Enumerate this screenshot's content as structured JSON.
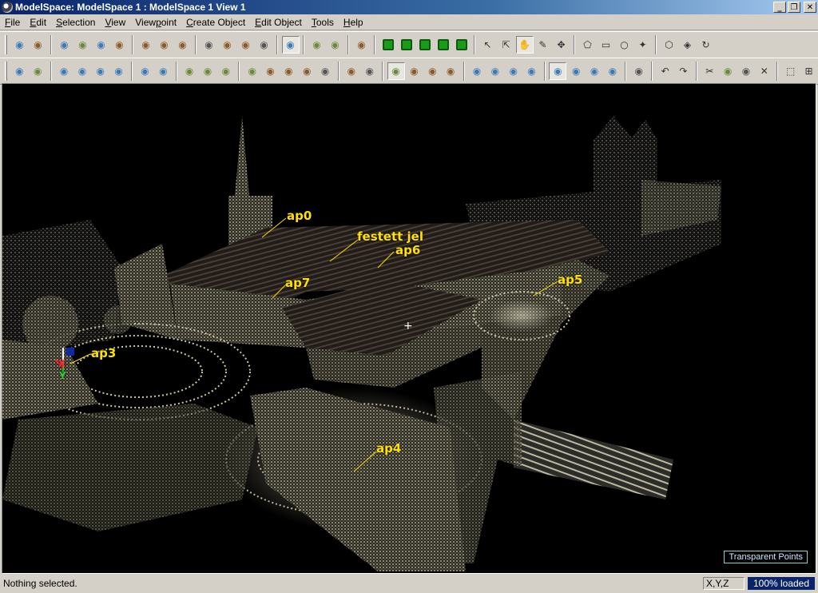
{
  "window": {
    "title": "ModelSpace: ModelSpace 1 : ModelSpace 1 View 1"
  },
  "window_controls": {
    "minimize": "_",
    "restore": "❐",
    "close": "✕"
  },
  "menu": [
    {
      "label": "File",
      "key": "F"
    },
    {
      "label": "Edit",
      "key": "E"
    },
    {
      "label": "Selection",
      "key": "S"
    },
    {
      "label": "View",
      "key": "V"
    },
    {
      "label": "Viewpoint",
      "key": "p"
    },
    {
      "label": "Create Object",
      "key": "C"
    },
    {
      "label": "Edit Object",
      "key": "E"
    },
    {
      "label": "Tools",
      "key": "T"
    },
    {
      "label": "Help",
      "key": "H"
    }
  ],
  "toolbar1_icons": [
    "fit-icon",
    "add-cloud-icon",
    "grip",
    "zoom-in-icon",
    "zoom-out-icon",
    "pan-icon",
    "orbit-icon",
    "sep",
    "cloud-rgb-icon",
    "color-map-icon",
    "intensity-icon",
    "sep",
    "render-icon",
    "shade-icon",
    "shade-alt-icon",
    "shade-alt2-icon",
    "sep",
    "transparent-icon",
    "sep",
    "grid-icon",
    "grid-alt-icon",
    "sep",
    "light-icon",
    "sep",
    "layer-1-icon",
    "layer-2-icon",
    "layer-3-icon",
    "layer-4-icon",
    "layer-5-icon",
    "sep",
    "select-arrow-icon",
    "select-plus-icon",
    "hand-icon",
    "pencil-icon",
    "move-icon",
    "sep",
    "fence-icon",
    "rectangle-icon",
    "circle-icon",
    "star-icon",
    "sep",
    "box-icon",
    "cube-icon",
    "rotate-icon"
  ],
  "toolbar2_icons": [
    "measure-icon",
    "tape-icon",
    "sep",
    "cloud-a-icon",
    "cloud-b-icon",
    "cloud-c-icon",
    "cloud-d-icon",
    "sep",
    "globe-a-icon",
    "globe-b-icon",
    "sep",
    "target-a-icon",
    "target-b-icon",
    "target-c-icon",
    "sep",
    "copy-icon",
    "paste-icon",
    "merge-icon",
    "knife-icon",
    "eraser-icon",
    "sep",
    "stack-icon",
    "layers-icon",
    "sep",
    "axis-icon",
    "plane-icon",
    "earth-icon",
    "spark-icon",
    "sep",
    "piece-a-icon",
    "piece-b-icon",
    "piece-c-icon",
    "piece-d-icon",
    "sep",
    "check-a-icon",
    "check-b-icon",
    "check-c-icon",
    "check-d-icon",
    "sep",
    "finger-icon",
    "sep",
    "undo-icon",
    "redo-icon",
    "sep",
    "cut-icon",
    "clip-icon",
    "paste2-icon",
    "cross-icon",
    "sep",
    "frame-icon",
    "frame2-icon"
  ],
  "scene_labels": [
    {
      "id": "ap0",
      "text": "ap0"
    },
    {
      "id": "festett",
      "text": "festett jel"
    },
    {
      "id": "ap6",
      "text": "ap6"
    },
    {
      "id": "ap7",
      "text": "ap7"
    },
    {
      "id": "ap5",
      "text": "ap5"
    },
    {
      "id": "ap3",
      "text": "ap3"
    },
    {
      "id": "ap4",
      "text": "ap4"
    }
  ],
  "axis_triad": {
    "x": "X",
    "y": "Y"
  },
  "viewport_button": "Transparent Points",
  "status": {
    "text": "Nothing selected.",
    "coords": "X,Y,Z",
    "load": "100% loaded"
  },
  "colors": {
    "label": "#ffe000",
    "title_start": "#0a246a",
    "title_end": "#a6caf0"
  }
}
